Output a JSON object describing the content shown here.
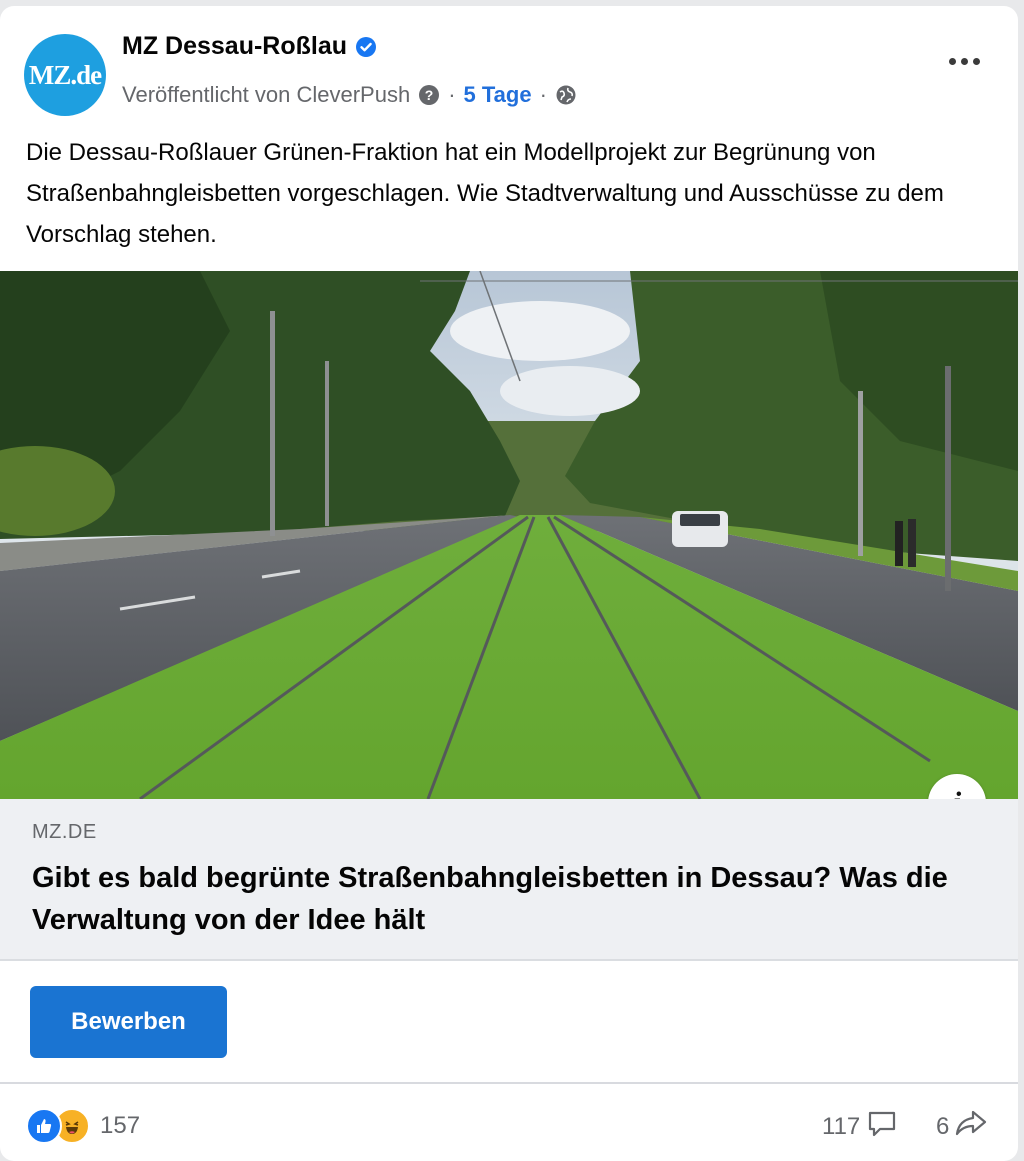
{
  "post": {
    "page_name": "MZ Dessau-Roßlau",
    "avatar_text": "MZ.de",
    "published_by": "Veröffentlicht von CleverPush",
    "time": "5 Tage",
    "text": "Die Dessau-Roßlauer Grünen-Fraktion hat ein Modellprojekt zur Begrünung von Straßenbahngleisbetten vorgeschlagen. Wie Stadtverwaltung und Ausschüsse zu dem Vorschlag stehen."
  },
  "link_preview": {
    "domain": "MZ.DE",
    "headline": "Gibt es bald begrünte Straßenbahngleisbetten in Dessau? Was die Verwaltung von der Idee hält",
    "info_label": "i"
  },
  "cta": {
    "label": "Bewerben"
  },
  "footer": {
    "reaction_count": "157",
    "comment_count": "117",
    "share_count": "6"
  },
  "colors": {
    "accent": "#1a74d2",
    "link_time": "#216fdb",
    "avatar_bg": "#1e9fe0"
  },
  "icons": {
    "verified": "verified-badge-icon",
    "help": "question-mark-icon",
    "globe": "globe-icon",
    "more": "more-dots-icon",
    "like": "like-reaction-icon",
    "haha": "haha-reaction-icon",
    "comment": "comment-icon",
    "share": "share-icon"
  }
}
